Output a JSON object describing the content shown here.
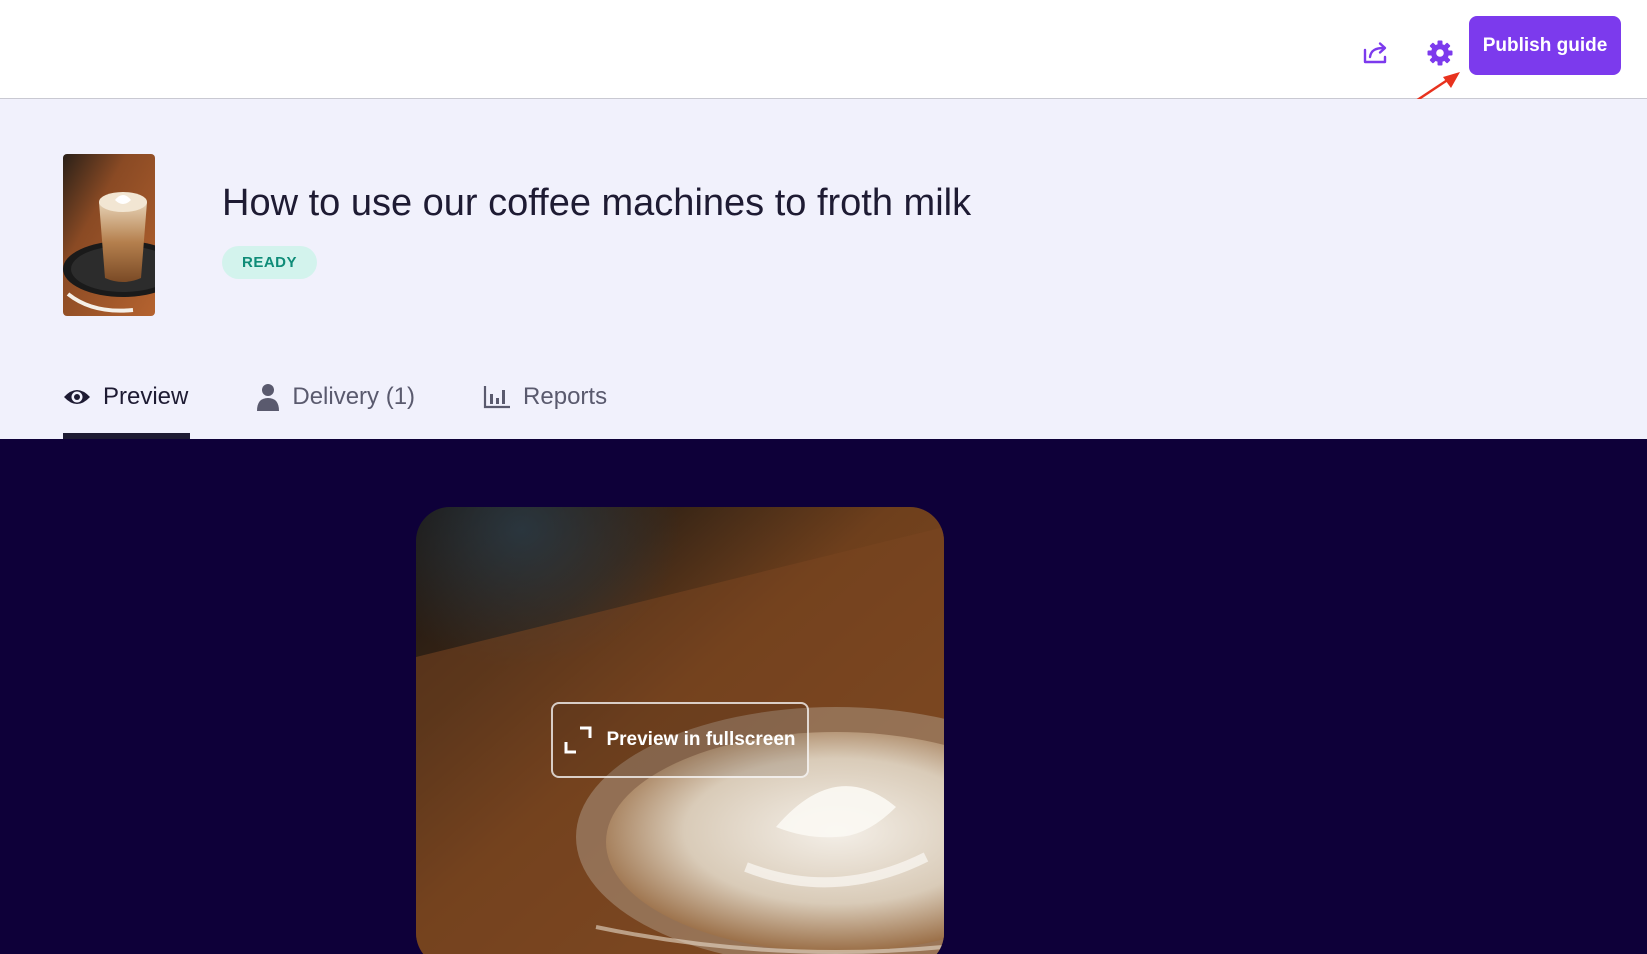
{
  "topbar": {
    "share_icon": "share-icon",
    "settings_icon": "gear-icon",
    "publish_label": "Publish guide"
  },
  "colors": {
    "accent": "#7c3aed",
    "header_bg": "#f1f1fc",
    "stage_bg": "#0e0039",
    "ready_bg": "#d3f3ed",
    "ready_text": "#0f8c78",
    "annotation": "#e8321e"
  },
  "guide": {
    "title": "How to use our coffee machines to froth milk",
    "status": "READY",
    "thumbnail": "latte-thumbnail"
  },
  "tabs": [
    {
      "label": "Preview",
      "icon": "eye-icon",
      "active": true
    },
    {
      "label": "Delivery (1)",
      "icon": "person-icon",
      "active": false
    },
    {
      "label": "Reports",
      "icon": "bar-chart-icon",
      "active": false
    }
  ],
  "preview": {
    "fullscreen_label": "Preview in fullscreen",
    "fullscreen_icon": "expand-icon"
  }
}
